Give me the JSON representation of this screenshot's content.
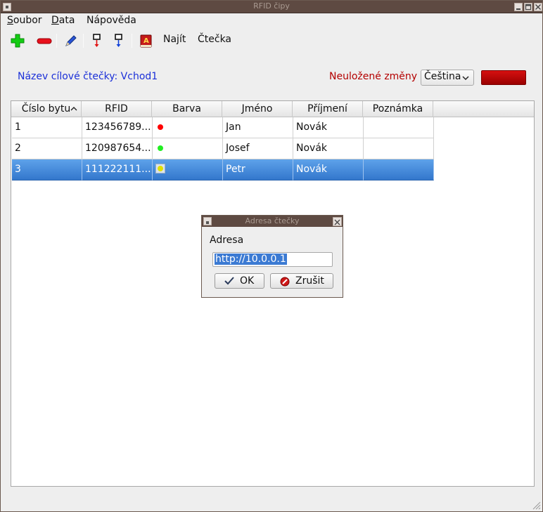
{
  "window": {
    "title": "RFID čipy"
  },
  "menu": [
    {
      "label": "Soubor",
      "key": "S",
      "rest": "oubor"
    },
    {
      "label": "Data",
      "key": "D",
      "rest": "ata"
    },
    {
      "label": "Nápověda",
      "key": "",
      "rest": "Nápověda"
    }
  ],
  "toolbar": {
    "icons": [
      "add-icon",
      "remove-icon",
      "edit-icon",
      "reader-read-icon",
      "reader-write-icon",
      "dictionary-icon"
    ],
    "find_label": "Najít",
    "reader_label": "Čtečka"
  },
  "header": {
    "reader_name": "Název cílové čtečky: Vchod1",
    "unsaved_label": "Neuložené změny",
    "language": "Čeština",
    "colors": {
      "reader_name": "#1a2fd8",
      "unsaved": "#b40000",
      "status": "#c00000"
    }
  },
  "table": {
    "columns": [
      "Číslo bytu",
      "RFID",
      "Barva",
      "Jméno",
      "Příjmení",
      "Poznámka"
    ],
    "sorted_column": "Číslo bytu",
    "sort_direction": "ascending",
    "rows": [
      {
        "number": "1",
        "rfid": "123456789...",
        "color": "#ff0000",
        "first": "Jan",
        "last": "Novák",
        "note": ""
      },
      {
        "number": "2",
        "rfid": "120987654...",
        "color": "#22ee22",
        "first": "Josef",
        "last": "Novák",
        "note": ""
      },
      {
        "number": "3",
        "rfid": "111222111...",
        "color": "#e0e000",
        "first": "Petr",
        "last": "Novák",
        "note": "",
        "selected": true
      }
    ]
  },
  "dialog": {
    "title": "Adresa čtečky",
    "label": "Adresa",
    "value": "http://10.0.0.1",
    "ok_label": "OK",
    "cancel_label": "Zrušit"
  }
}
